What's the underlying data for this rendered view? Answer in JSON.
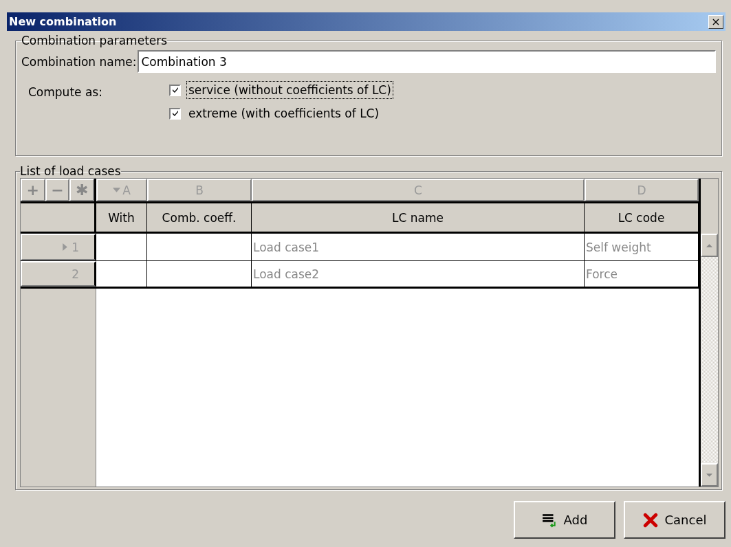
{
  "window": {
    "title": "New combination",
    "close": "×"
  },
  "parameters": {
    "legend": "Combination parameters",
    "name_label": "Combination name:",
    "name_value": "Combination 3",
    "compute_label": "Compute as:",
    "options": [
      {
        "label": "service (without coefficients of LC)",
        "checked": true,
        "focused": true
      },
      {
        "label": "extreme (with coefficients of LC)",
        "checked": true,
        "focused": false
      }
    ]
  },
  "load_cases": {
    "legend": "List of load cases",
    "tools": [
      "+",
      "−",
      "✱"
    ],
    "column_letters": [
      {
        "label": "A",
        "sorted": true
      },
      {
        "label": "B",
        "sorted": false
      },
      {
        "label": "C",
        "sorted": false
      },
      {
        "label": "D",
        "sorted": false
      }
    ],
    "columns": [
      "With",
      "Comb. coeff.",
      "LC name",
      "LC code"
    ],
    "rows": [
      {
        "number": "1",
        "selected": true,
        "with": "",
        "coeff": "",
        "name": "Load case1",
        "code": "Self weight"
      },
      {
        "number": "2",
        "selected": false,
        "with": "",
        "coeff": "",
        "name": "Load case2",
        "code": "Force"
      }
    ]
  },
  "buttons": [
    {
      "kind": "add",
      "label": "Add"
    },
    {
      "kind": "cancel",
      "label": "Cancel"
    }
  ]
}
